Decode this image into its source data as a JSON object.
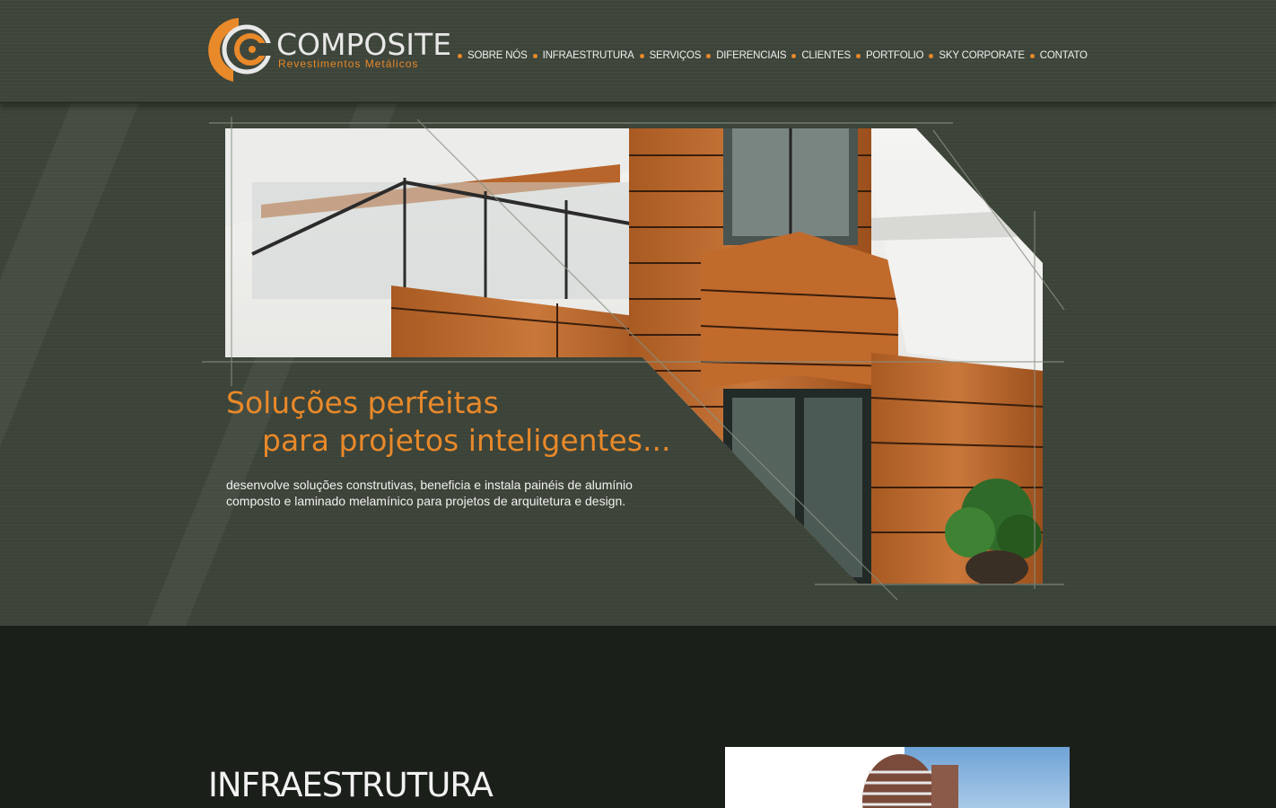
{
  "brand": {
    "name": "COMPOSITE",
    "tagline": "Revestimentos Metálicos"
  },
  "nav": {
    "items": [
      {
        "label": "SOBRE NÓS"
      },
      {
        "label": "INFRAESTRUTURA"
      },
      {
        "label": "SERVIÇOS"
      },
      {
        "label": "DIFERENCIAIS"
      },
      {
        "label": "CLIENTES"
      },
      {
        "label": "PORTFOLIO"
      },
      {
        "label": "SKY CORPORATE"
      },
      {
        "label": "CONTATO"
      }
    ]
  },
  "hero": {
    "headline_line1": "Soluções perfeitas",
    "headline_line2": "para projetos inteligentes...",
    "description": "desenvolve soluções construtivas, beneficia e instala painéis de alumínio composto e laminado melamínico para projetos de arquitetura e design."
  },
  "infra": {
    "title": "INFRAESTRUTURA"
  },
  "colors": {
    "accent": "#e8892a",
    "background": "#3c4338",
    "dark_section": "#1b1f1a",
    "text": "#f2f2f2"
  }
}
